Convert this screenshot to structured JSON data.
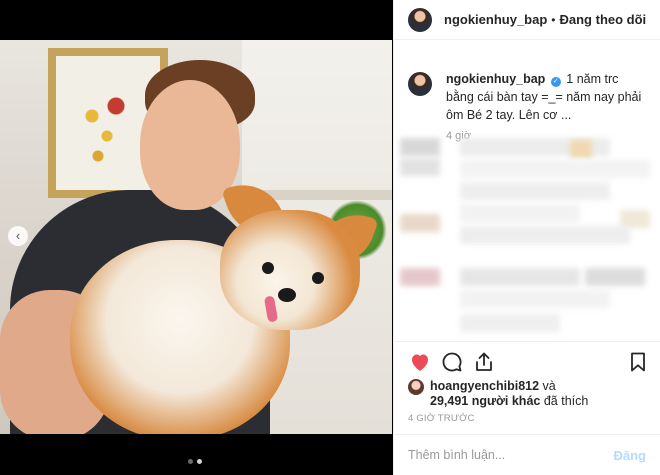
{
  "header": {
    "username": "ngokienhuy_bap",
    "separator": "•",
    "follow_status": "Đang theo dõi"
  },
  "caption": {
    "username": "ngokienhuy_bap",
    "verified_glyph": "✓",
    "text": "1 năm trc bằng cái bàn tay =_= năm nay phải ôm Bé 2 tay. Lên cơ ...",
    "time": "4 giờ"
  },
  "media": {
    "prev_glyph": "‹",
    "carousel_dots": 2,
    "active_dot": 1
  },
  "icons": [
    "heart-icon",
    "comment-icon",
    "share-icon",
    "bookmark-icon",
    "chevron-left-icon",
    "verified-icon"
  ],
  "actions": {
    "like_color": "#ed4956"
  },
  "likes": {
    "user": "hoangyenchibi812",
    "and": "và",
    "count_text": "29,491 người khác",
    "suffix": "đã thích"
  },
  "post_time": "4 GIỜ TRƯỚC",
  "comment": {
    "placeholder": "Thêm bình luận...",
    "post_label": "Đăng"
  }
}
